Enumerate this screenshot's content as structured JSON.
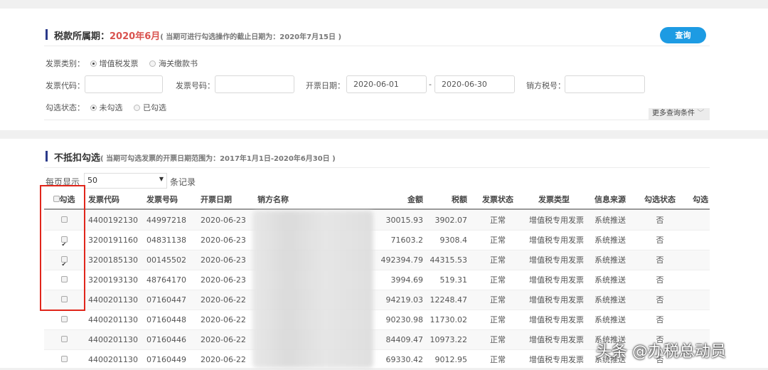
{
  "period_section": {
    "title": "税款所属期：",
    "period": "2020年6月",
    "note": "( 当期可进行勾选操作的截止日期为：2020年7月15日 )",
    "query_button": "查询",
    "invoice_category_label": "发票类别：",
    "invoice_category_options": [
      "增值税发票",
      "海关缴款书"
    ],
    "invoice_category_selected": "增值税发票",
    "invoice_code_label": "发票代码：",
    "invoice_code_value": "",
    "invoice_number_label": "发票号码：",
    "invoice_number_value": "",
    "issue_date_label": "开票日期：",
    "date_from": "2020-06-01",
    "date_sep": "-",
    "date_to": "2020-06-30",
    "seller_tax_id_label": "销方税号：",
    "seller_tax_id_value": "",
    "check_status_label": "勾选状态：",
    "check_status_options": [
      "未勾选",
      "已勾选"
    ],
    "check_status_selected": "未勾选",
    "more_conditions": "更多查询条件"
  },
  "list_section": {
    "title": "不抵扣勾选",
    "note": "( 当期可勾选发票的开票日期范围为：2017年1月1日-2020年6月30日 )",
    "page_size_label": "每页显示",
    "page_size": "50",
    "page_size_suffix": "条记录",
    "columns": [
      "勾选",
      "发票代码",
      "发票号码",
      "开票日期",
      "销方名称",
      "金额",
      "税额",
      "发票状态",
      "发票类型",
      "信息来源",
      "勾选状态",
      "勾选"
    ],
    "rows": [
      {
        "checked": false,
        "code": "4400192130",
        "number": "44997218",
        "date": "2020-06-23",
        "amount": "30015.93",
        "tax": "3902.07",
        "status": "正常",
        "type": "增值税专用发票",
        "source": "系统推送",
        "check_status": "否"
      },
      {
        "checked": true,
        "code": "3200191160",
        "number": "04831138",
        "date": "2020-06-23",
        "amount": "71603.2",
        "tax": "9308.4",
        "status": "正常",
        "type": "增值税专用发票",
        "source": "系统推送",
        "check_status": "否"
      },
      {
        "checked": true,
        "code": "3200185130",
        "number": "00145502",
        "date": "2020-06-23",
        "amount": "492394.79",
        "tax": "44315.53",
        "status": "正常",
        "type": "增值税专用发票",
        "source": "系统推送",
        "check_status": "否"
      },
      {
        "checked": false,
        "code": "3200193130",
        "number": "48764170",
        "date": "2020-06-23",
        "amount": "3994.69",
        "tax": "519.31",
        "status": "正常",
        "type": "增值税专用发票",
        "source": "系统推送",
        "check_status": "否"
      },
      {
        "checked": false,
        "code": "4400201130",
        "number": "07160447",
        "date": "2020-06-22",
        "amount": "94219.03",
        "tax": "12248.47",
        "status": "正常",
        "type": "增值税专用发票",
        "source": "系统推送",
        "check_status": "否"
      },
      {
        "checked": false,
        "code": "4400201130",
        "number": "07160448",
        "date": "2020-06-22",
        "amount": "90230.98",
        "tax": "11730.02",
        "status": "正常",
        "type": "增值税专用发票",
        "source": "系统推送",
        "check_status": "否"
      },
      {
        "checked": false,
        "code": "4400201130",
        "number": "07160446",
        "date": "2020-06-22",
        "amount": "84409.47",
        "tax": "10973.22",
        "status": "正常",
        "type": "增值税专用发票",
        "source": "系统推送",
        "check_status": "否"
      },
      {
        "checked": false,
        "code": "4400201130",
        "number": "07160449",
        "date": "2020-06-22",
        "amount": "69330.42",
        "tax": "9012.95",
        "status": "正常",
        "type": "增值税专用发票",
        "source": "系统推送",
        "check_status": "否"
      }
    ]
  },
  "watermark": "头条 @办税总动员",
  "colors": {
    "accent": "#1d9be3",
    "period": "#d9534f",
    "highlight_box": "#e0261b",
    "title_bar": "#2b3a8a"
  }
}
